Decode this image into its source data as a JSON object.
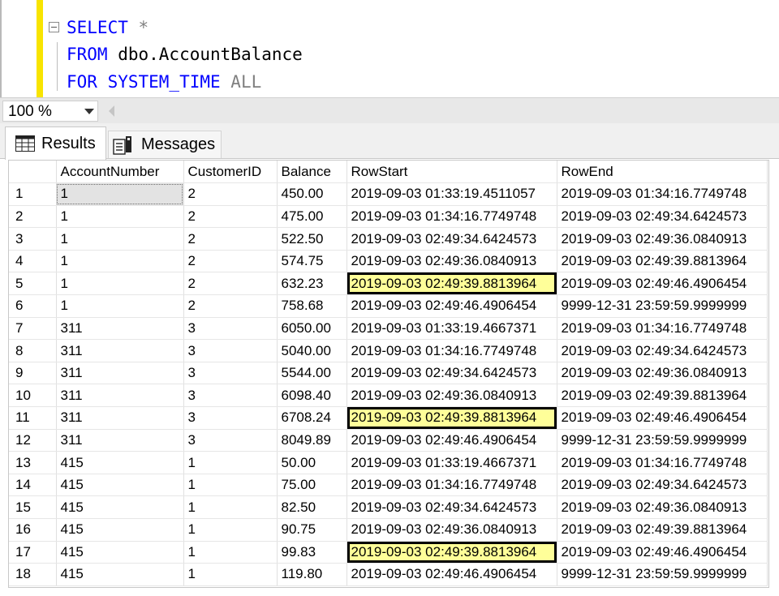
{
  "editor": {
    "line1": {
      "keyword": "SELECT",
      "rest": " *"
    },
    "line2": {
      "keyword": "FROM",
      "rest": " dbo.AccountBalance"
    },
    "line3": {
      "keyword": "FOR SYSTEM_TIME",
      "rest": " ALL"
    }
  },
  "zoom": {
    "value": "100 %"
  },
  "tabs": {
    "results": "Results",
    "messages": "Messages"
  },
  "grid": {
    "columns": [
      "",
      "AccountNumber",
      "CustomerID",
      "Balance",
      "RowStart",
      "RowEnd"
    ],
    "rows": [
      [
        "1",
        "1",
        "2",
        "450.00",
        "2019-09-03 01:33:19.4511057",
        "2019-09-03 01:34:16.7749748"
      ],
      [
        "2",
        "1",
        "2",
        "475.00",
        "2019-09-03 01:34:16.7749748",
        "2019-09-03 02:49:34.6424573"
      ],
      [
        "3",
        "1",
        "2",
        "522.50",
        "2019-09-03 02:49:34.6424573",
        "2019-09-03 02:49:36.0840913"
      ],
      [
        "4",
        "1",
        "2",
        "574.75",
        "2019-09-03 02:49:36.0840913",
        "2019-09-03 02:49:39.8813964"
      ],
      [
        "5",
        "1",
        "2",
        "632.23",
        "2019-09-03 02:49:39.8813964",
        "2019-09-03 02:49:46.4906454"
      ],
      [
        "6",
        "1",
        "2",
        "758.68",
        "2019-09-03 02:49:46.4906454",
        "9999-12-31 23:59:59.9999999"
      ],
      [
        "7",
        "311",
        "3",
        "6050.00",
        "2019-09-03 01:33:19.4667371",
        "2019-09-03 01:34:16.7749748"
      ],
      [
        "8",
        "311",
        "3",
        "5040.00",
        "2019-09-03 01:34:16.7749748",
        "2019-09-03 02:49:34.6424573"
      ],
      [
        "9",
        "311",
        "3",
        "5544.00",
        "2019-09-03 02:49:34.6424573",
        "2019-09-03 02:49:36.0840913"
      ],
      [
        "10",
        "311",
        "3",
        "6098.40",
        "2019-09-03 02:49:36.0840913",
        "2019-09-03 02:49:39.8813964"
      ],
      [
        "11",
        "311",
        "3",
        "6708.24",
        "2019-09-03 02:49:39.8813964",
        "2019-09-03 02:49:46.4906454"
      ],
      [
        "12",
        "311",
        "3",
        "8049.89",
        "2019-09-03 02:49:46.4906454",
        "9999-12-31 23:59:59.9999999"
      ],
      [
        "13",
        "415",
        "1",
        "50.00",
        "2019-09-03 01:33:19.4667371",
        "2019-09-03 01:34:16.7749748"
      ],
      [
        "14",
        "415",
        "1",
        "75.00",
        "2019-09-03 01:34:16.7749748",
        "2019-09-03 02:49:34.6424573"
      ],
      [
        "15",
        "415",
        "1",
        "82.50",
        "2019-09-03 02:49:34.6424573",
        "2019-09-03 02:49:36.0840913"
      ],
      [
        "16",
        "415",
        "1",
        "90.75",
        "2019-09-03 02:49:36.0840913",
        "2019-09-03 02:49:39.8813964"
      ],
      [
        "17",
        "415",
        "1",
        "99.83",
        "2019-09-03 02:49:39.8813964",
        "2019-09-03 02:49:46.4906454"
      ],
      [
        "18",
        "415",
        "1",
        "119.80",
        "2019-09-03 02:49:46.4906454",
        "9999-12-31 23:59:59.9999999"
      ]
    ],
    "highlighted_rows": [
      4,
      10,
      16
    ],
    "highlight_color": "#ffff99",
    "selected_cell": {
      "row": 0,
      "col": 1
    }
  },
  "colors": {
    "keyword": "#0000ff",
    "margin_bar": "#f8e400"
  }
}
